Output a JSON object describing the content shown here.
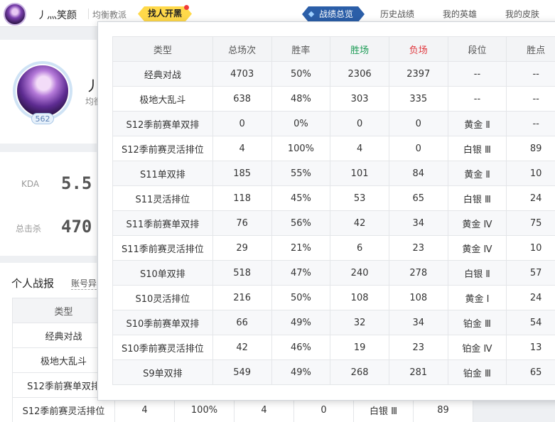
{
  "header": {
    "username": "丿灬笑颜",
    "tag": "均衡教派",
    "find_button": "找人开黑",
    "nav": [
      "战绩总览",
      "历史战绩",
      "我的英雄",
      "我的皮肤"
    ]
  },
  "profile": {
    "name_partial": "丿",
    "sub_partial": "均衡",
    "level": "562"
  },
  "stats": {
    "kda_label": "KDA",
    "kda_value": "5.5",
    "kills_label": "总击杀",
    "kills_value": "470"
  },
  "report": {
    "title": "个人战报",
    "link_partial": "账号异"
  },
  "bg_table": {
    "header": "类型",
    "rows": [
      {
        "type": "经典对战"
      },
      {
        "type": "极地大乱斗"
      },
      {
        "type": "S12季前赛单双排"
      },
      {
        "type": "S12季前赛灵活排位",
        "total": "4",
        "rate": "100%",
        "win": "4",
        "loss": "0",
        "rank": "白银 Ⅲ",
        "points": "89"
      }
    ]
  },
  "popup": {
    "columns": [
      "类型",
      "总场次",
      "胜率",
      "胜场",
      "负场",
      "段位",
      "胜点"
    ],
    "colors": {
      "win": "#1c9b55",
      "loss": "#e0383e"
    },
    "rows": [
      [
        "经典对战",
        "4703",
        "50%",
        "2306",
        "2397",
        "--",
        "--"
      ],
      [
        "极地大乱斗",
        "638",
        "48%",
        "303",
        "335",
        "--",
        "--"
      ],
      [
        "S12季前赛单双排",
        "0",
        "0%",
        "0",
        "0",
        "黄金 Ⅱ",
        "--"
      ],
      [
        "S12季前赛灵活排位",
        "4",
        "100%",
        "4",
        "0",
        "白银 Ⅲ",
        "89"
      ],
      [
        "S11单双排",
        "185",
        "55%",
        "101",
        "84",
        "黄金 Ⅱ",
        "10"
      ],
      [
        "S11灵活排位",
        "118",
        "45%",
        "53",
        "65",
        "白银 Ⅲ",
        "24"
      ],
      [
        "S11季前赛单双排",
        "76",
        "56%",
        "42",
        "34",
        "黄金 Ⅳ",
        "75"
      ],
      [
        "S11季前赛灵活排位",
        "29",
        "21%",
        "6",
        "23",
        "黄金 Ⅳ",
        "10"
      ],
      [
        "S10单双排",
        "518",
        "47%",
        "240",
        "278",
        "白银 Ⅱ",
        "57"
      ],
      [
        "S10灵活排位",
        "216",
        "50%",
        "108",
        "108",
        "黄金 Ⅰ",
        "24"
      ],
      [
        "S10季前赛单双排",
        "66",
        "49%",
        "32",
        "34",
        "铂金 Ⅲ",
        "54"
      ],
      [
        "S10季前赛灵活排位",
        "42",
        "46%",
        "19",
        "23",
        "铂金 Ⅳ",
        "13"
      ],
      [
        "S9单双排",
        "549",
        "49%",
        "268",
        "281",
        "铂金 Ⅲ",
        "65"
      ]
    ]
  }
}
